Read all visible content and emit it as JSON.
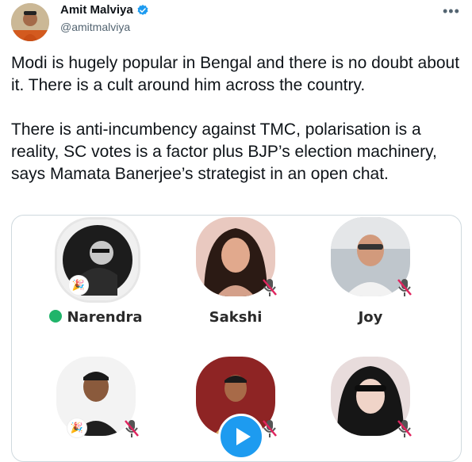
{
  "author": {
    "name": "Amit Malviya",
    "handle": "@amitmalviya",
    "verified_icon": "verified-badge-icon",
    "more_label": "•••"
  },
  "tweet": {
    "paragraph1": "Modi is hugely popular in Bengal and there is no doubt about it. There is a cult around him across the country.",
    "paragraph2": "There is anti-incumbency against TMC, polarisation is a reality, SC votes is a factor plus BJP’s election machinery, says Mamata Banerjee’s strategist in an open chat."
  },
  "media": {
    "speakers": [
      {
        "label": "Narendra",
        "badge": "🎉"
      },
      {
        "label": "Sakshi"
      },
      {
        "label": "Joy"
      },
      {
        "label": "",
        "badge": "🎉"
      },
      {
        "label": ""
      },
      {
        "label": ""
      }
    ],
    "play_icon": "play-icon"
  },
  "colors": {
    "accent": "#1d9bf0",
    "moderator": "#20b46a",
    "muted_mic": "#e0245e"
  }
}
